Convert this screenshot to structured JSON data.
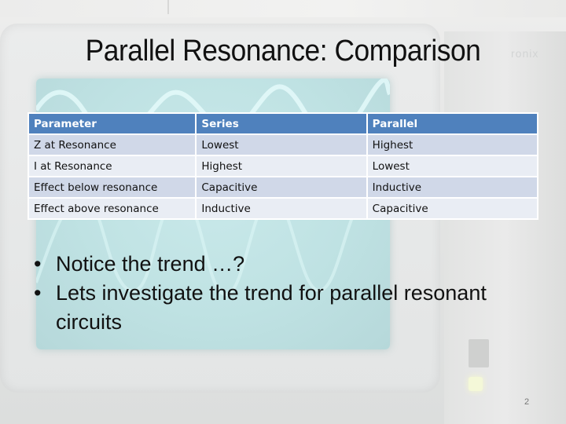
{
  "slide": {
    "title": "Parallel Resonance: Comparison",
    "page_number": "2",
    "background_logo": "ronix"
  },
  "table": {
    "headers": [
      "Parameter",
      "Series",
      "Parallel"
    ],
    "rows": [
      [
        "Z at Resonance",
        "Lowest",
        "Highest"
      ],
      [
        "I at Resonance",
        "Highest",
        "Lowest"
      ],
      [
        "Effect below resonance",
        "Capacitive",
        "Inductive"
      ],
      [
        "Effect above resonance",
        "Inductive",
        "Capacitive"
      ]
    ],
    "colors": {
      "header": "#4f81bd",
      "row_odd": "#d0d8e8",
      "row_even": "#e9edf4"
    }
  },
  "bullets": [
    {
      "marker": "•",
      "text": "Notice the trend …?"
    },
    {
      "marker": "•",
      "text": "Lets investigate the trend for parallel resonant circuits"
    }
  ]
}
